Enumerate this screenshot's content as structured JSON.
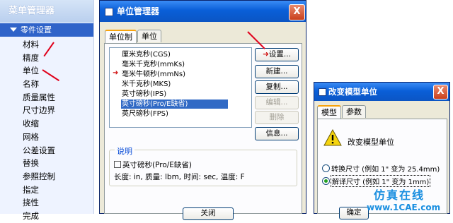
{
  "menu": {
    "title": "菜单管理器",
    "section": "零件设置",
    "items": [
      "材料",
      "精度",
      "单位",
      "名称",
      "质量属性",
      "尺寸边界",
      "收缩",
      "网格",
      "公差设置",
      "替换",
      "参照控制",
      "指定",
      "挠性",
      "完成"
    ]
  },
  "unit_manager": {
    "title": "单位管理器",
    "close_label": "X",
    "tabs": [
      "单位制",
      "单位"
    ],
    "systems": [
      "厘米克秒(CGS)",
      "毫米千克秒(mmKs)",
      "毫米牛顿秒(mmNs)",
      "米千克秒(MKS)",
      "英寸磅秒(IPS)",
      "英寸磅秒(Pro/E缺省)",
      "英尺磅秒(FPS)"
    ],
    "selected_index": 5,
    "current_index": 2,
    "buttons": {
      "set": "设置...",
      "new": "新建...",
      "copy": "复制...",
      "edit": "编辑...",
      "delete": "删除",
      "info": "信息..."
    },
    "description_label": "说明",
    "description_name": "英寸磅秒(Pro/E缺省)",
    "description_detail": "长度: in, 质量: lbm, 时间: sec, 温度: F",
    "close_button": "关闭"
  },
  "change_model": {
    "title": "改变模型单位",
    "close_label": "X",
    "tabs": [
      "模型",
      "参数"
    ],
    "message": "改变模型单位",
    "options": [
      "转换尺寸 (例如 1\" 变为 25.4mm)",
      "解译尺寸 (例如 1\" 变为 1mm)"
    ],
    "selected_option": 1,
    "ok_button": "确定"
  },
  "watermark": {
    "text1": "仿真在线",
    "text2": "www.1CAE.com"
  },
  "colors": {
    "accent": "#2f63c9",
    "titlebar": "#0a5fd8",
    "arrow": "#e0001b",
    "selection": "#316ac5"
  }
}
